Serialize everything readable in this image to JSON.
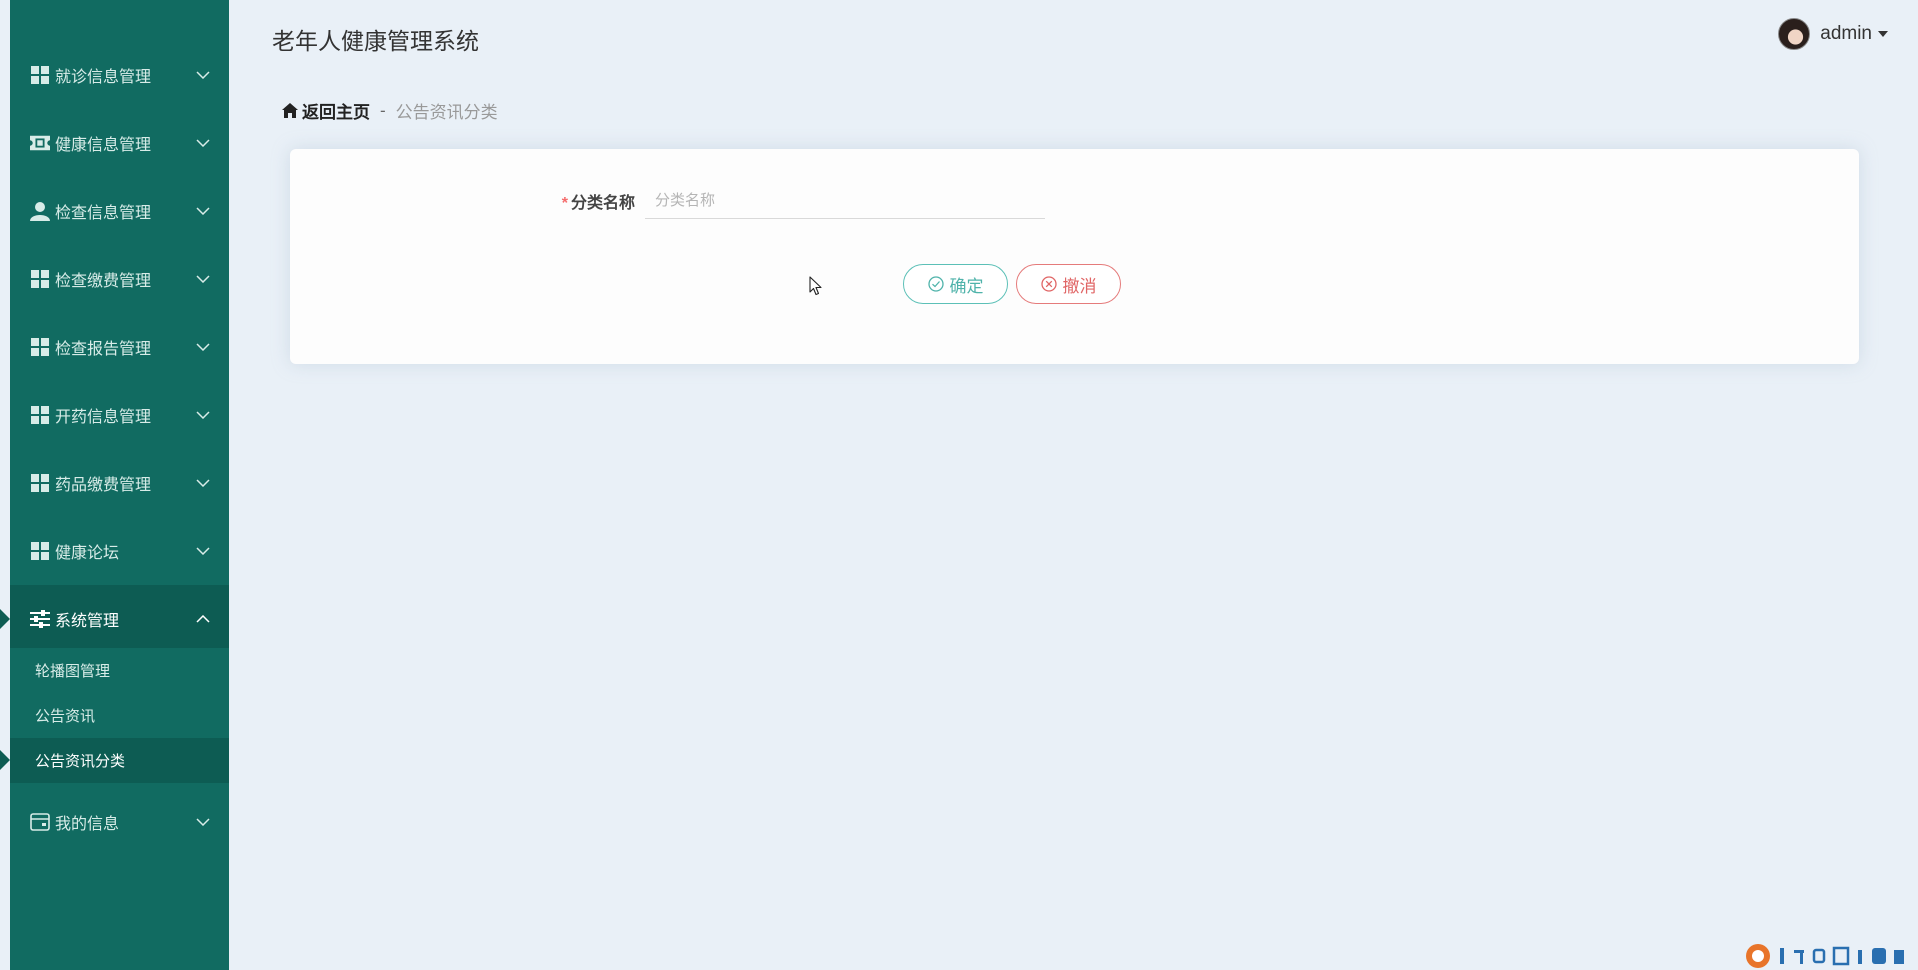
{
  "app": {
    "title": "老年人健康管理系统"
  },
  "user": {
    "name": "admin"
  },
  "sidebar": {
    "items": [
      {
        "label": "就诊信息管理",
        "icon": "grid-icon"
      },
      {
        "label": "健康信息管理",
        "icon": "ticket-icon"
      },
      {
        "label": "检查信息管理",
        "icon": "user-icon"
      },
      {
        "label": "检查缴费管理",
        "icon": "grid-icon"
      },
      {
        "label": "检查报告管理",
        "icon": "grid-icon"
      },
      {
        "label": "开药信息管理",
        "icon": "grid-icon"
      },
      {
        "label": "药品缴费管理",
        "icon": "grid-icon"
      },
      {
        "label": "健康论坛",
        "icon": "grid-icon"
      },
      {
        "label": "系统管理",
        "icon": "sliders-icon",
        "expanded": true
      },
      {
        "label": "我的信息",
        "icon": "card-icon"
      }
    ],
    "submenu": [
      {
        "label": "轮播图管理"
      },
      {
        "label": "公告资讯"
      },
      {
        "label": "公告资讯分类",
        "active": true
      }
    ]
  },
  "breadcrumb": {
    "home": "返回主页",
    "separator": "-",
    "current": "公告资讯分类"
  },
  "form": {
    "required_mark": "*",
    "field_label": "分类名称",
    "field_placeholder": "分类名称",
    "field_value": "",
    "confirm_label": "确定",
    "cancel_label": "撤消"
  },
  "colors": {
    "sidebar_bg": "#116b61",
    "sidebar_active_bg": "#0d5c53",
    "page_bg": "#e9f0f7",
    "confirm": "#4fb3aa",
    "cancel": "#e06565"
  }
}
